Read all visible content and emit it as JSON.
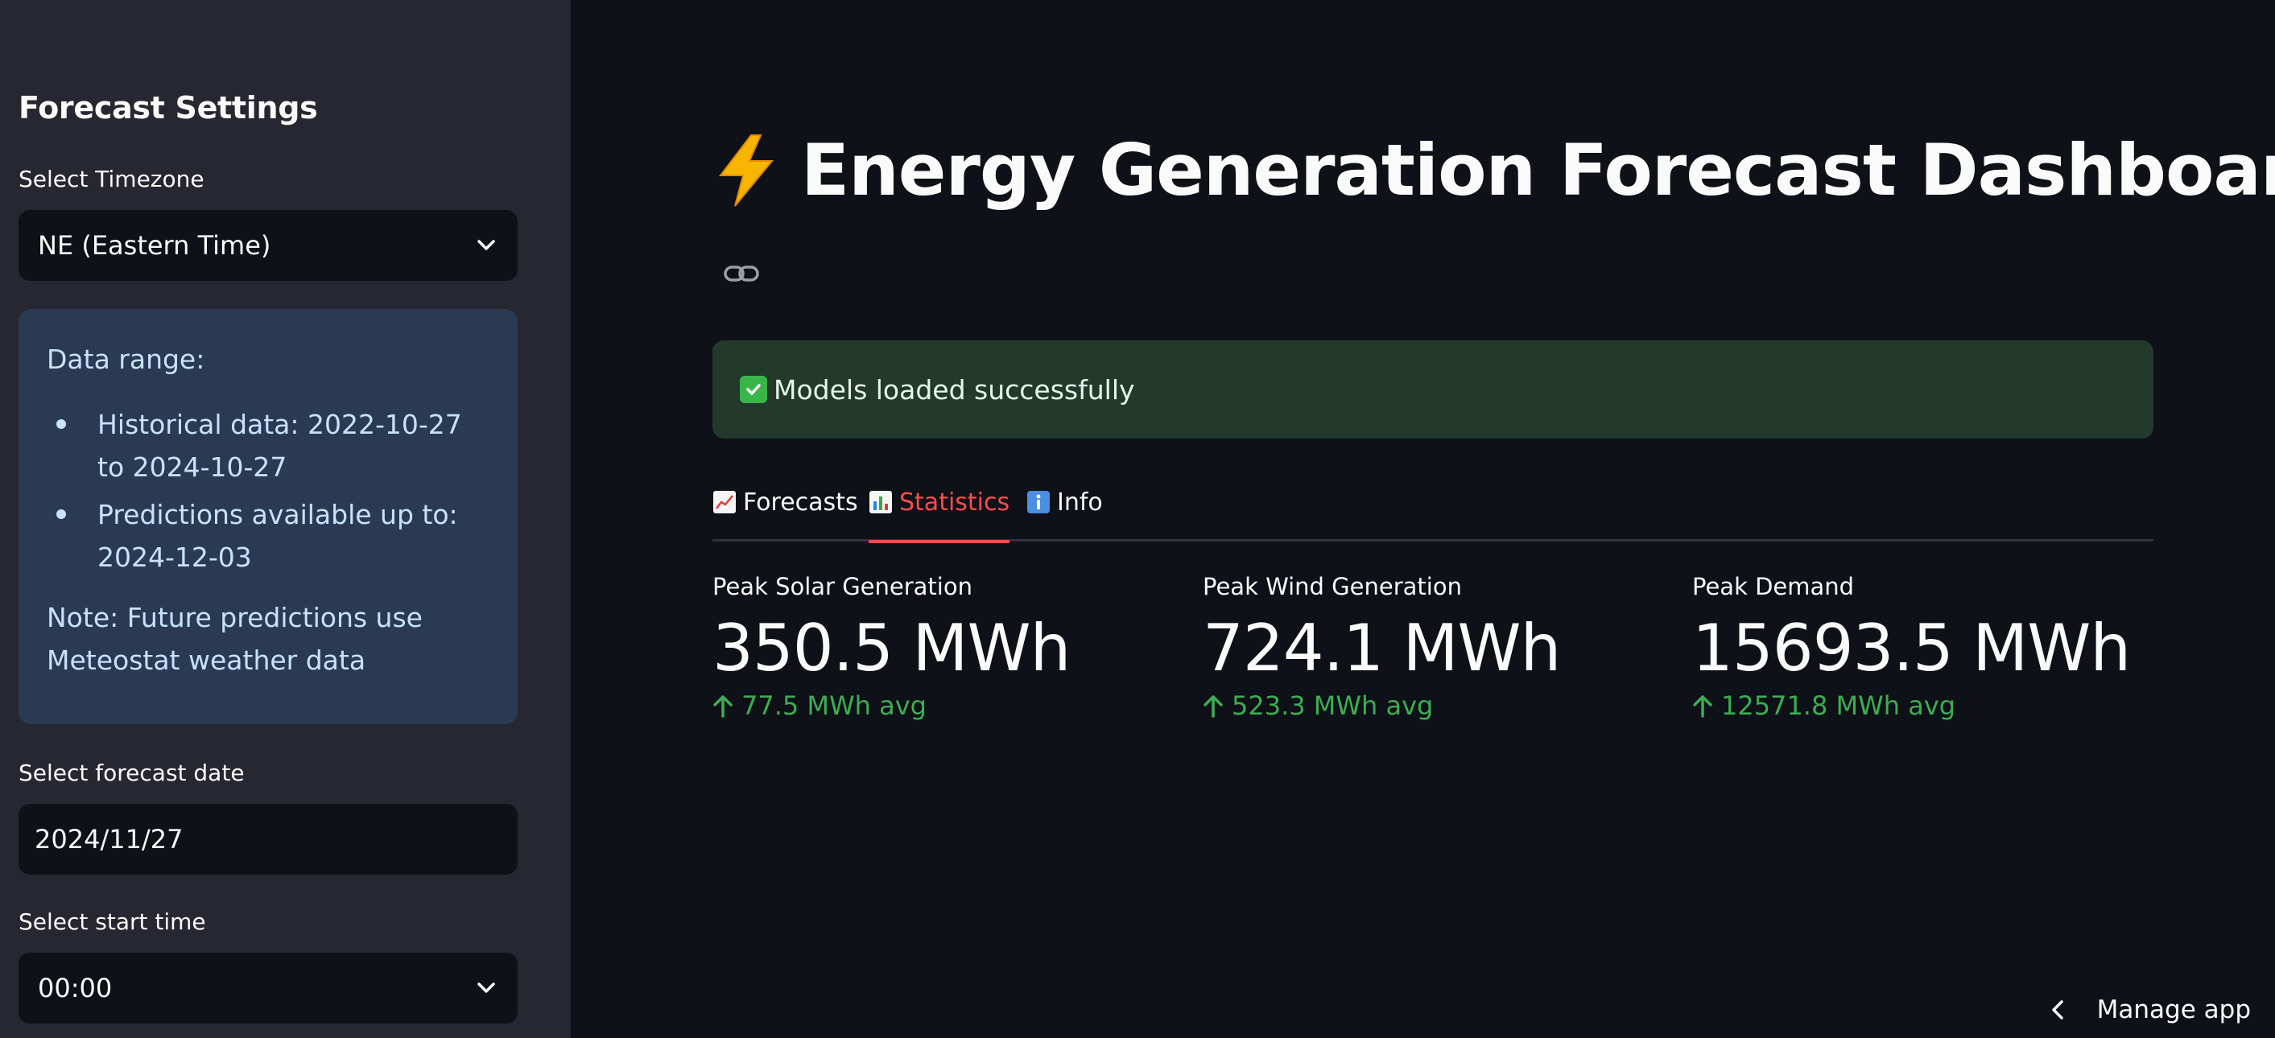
{
  "sidebar": {
    "title": "Forecast Settings",
    "timezone_label": "Select Timezone",
    "timezone_value": "NE (Eastern Time)",
    "info": {
      "heading": "Data range:",
      "items": [
        "Historical data: 2022-10-27 to 2024-10-27",
        "Predictions available up to: 2024-12-03"
      ],
      "note": "Note: Future predictions use Meteostat weather data"
    },
    "date_label": "Select forecast date",
    "date_value": "2024/11/27",
    "time_label": "Select start time",
    "time_value": "00:00"
  },
  "main": {
    "title": "Energy Generation Forecast Dashboard",
    "title_icon": "lightning-bolt-icon",
    "alert": {
      "text": "Models loaded successfully",
      "icon": "check-mark-icon",
      "color": "#23392c"
    },
    "tabs": [
      {
        "label": "Forecasts",
        "icon": "chart-increasing-icon",
        "active": false
      },
      {
        "label": "Statistics",
        "icon": "bar-chart-icon",
        "active": true
      },
      {
        "label": "Info",
        "icon": "information-icon",
        "active": false
      }
    ],
    "metrics": [
      {
        "label": "Peak Solar Generation",
        "value": "350.5 MWh",
        "delta": "77.5 MWh avg"
      },
      {
        "label": "Peak Wind Generation",
        "value": "724.1 MWh",
        "delta": "523.3 MWh avg"
      },
      {
        "label": "Peak Demand",
        "value": "15693.5 MWh",
        "delta": "12571.8 MWh avg"
      }
    ]
  },
  "footer": {
    "manage_label": "Manage app"
  },
  "colors": {
    "background": "#0e1117",
    "sidebar": "#262730",
    "accent": "#ff4b4b",
    "delta_positive": "#3dad52",
    "info_box": "#2a3a52"
  }
}
